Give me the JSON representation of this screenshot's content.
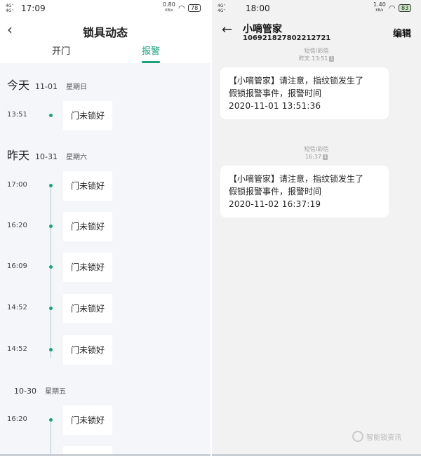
{
  "left_phone": {
    "status_bar": {
      "net": "4G⁺\n4G⁺",
      "time": "17:09",
      "speed": "0.80",
      "speed_unit": "KB/s",
      "battery": "78"
    },
    "header": {
      "title": "锁具动态"
    },
    "tabs": [
      {
        "label": "开门"
      },
      {
        "label": "报警"
      }
    ],
    "days": [
      {
        "name": "今天",
        "date": "11-01",
        "weekday": "星期日"
      },
      {
        "name": "昨天",
        "date": "10-31",
        "weekday": "星期六"
      },
      {
        "name": "",
        "date": "10-30",
        "weekday": "星期五"
      }
    ],
    "entries": [
      {
        "time": "13:51",
        "text": "门未锁好"
      },
      {
        "time": "17:00",
        "text": "门未锁好"
      },
      {
        "time": "16:20",
        "text": "门未锁好"
      },
      {
        "time": "16:09",
        "text": "门未锁好"
      },
      {
        "time": "14:52",
        "text": "门未锁好"
      },
      {
        "time": "14:52",
        "text": "门未锁好"
      },
      {
        "time": "16:20",
        "text": "门未锁好"
      },
      {
        "time": "",
        "text": ""
      }
    ]
  },
  "right_phone": {
    "status_bar": {
      "net": "4G⁺\n4G⁺",
      "time": "18:00",
      "speed": "1.40",
      "speed_unit": "KB/s",
      "battery": "83"
    },
    "header": {
      "contact_name": "小嘀管家",
      "contact_number": "106921827802212721",
      "edit_label": "编辑"
    },
    "messages": [
      {
        "type_label": "短信/彩信",
        "timestamp": "昨天 13:51",
        "sim": "1",
        "line1": "【小嘀管家】请注意，指纹锁发生了",
        "line2": "假锁报警事件，报警时间",
        "line3": "2020-11-01 13:51:36"
      },
      {
        "type_label": "短信/彩信",
        "timestamp": "16:37",
        "sim": "1",
        "line1": "【小嘀管家】请注意，指纹锁发生了",
        "line2": "假锁报警事件，报警时间",
        "line3": "2020-11-02 16:37:19"
      }
    ],
    "watermark": "智能锁资讯"
  }
}
